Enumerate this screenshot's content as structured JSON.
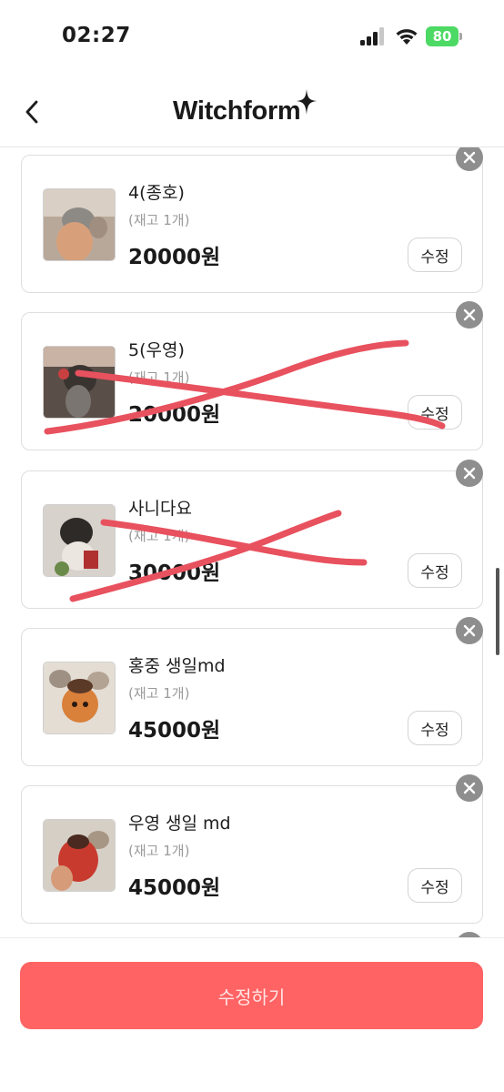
{
  "status_bar": {
    "time": "02:27",
    "battery": "80"
  },
  "header": {
    "logo_text": "Witchform"
  },
  "items": [
    {
      "name": "4(종호)",
      "stock": "(재고 1개)",
      "price": "20000원",
      "edit_label": "수정",
      "struck": false
    },
    {
      "name": "5(우영)",
      "stock": "(재고 1개)",
      "price": "20000원",
      "edit_label": "수정",
      "struck": true
    },
    {
      "name": "사니다요",
      "stock": "(재고 1개)",
      "price": "30000원",
      "edit_label": "수정",
      "struck": true
    },
    {
      "name": "홍중 생일md",
      "stock": "(재고 1개)",
      "price": "45000원",
      "edit_label": "수정",
      "struck": false
    },
    {
      "name": "우영 생일 md",
      "stock": "(재고 1개)",
      "price": "45000원",
      "edit_label": "수정",
      "struck": false
    }
  ],
  "footer": {
    "submit_label": "수정하기"
  },
  "colors": {
    "accent": "#ff6363",
    "strike": "#e8515e",
    "battery": "#4cd964"
  }
}
